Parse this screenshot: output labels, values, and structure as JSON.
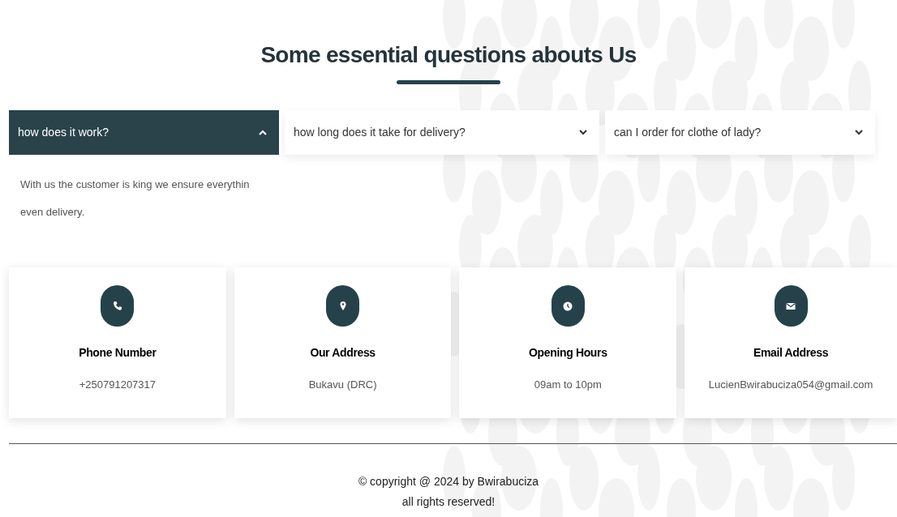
{
  "heading": "Some essential questions abouts Us",
  "faq": [
    {
      "question": "how does it work?",
      "expanded": true,
      "answer": "With us the customer is king we ensure everythin even delivery."
    },
    {
      "question": "how long does it take for delivery?",
      "expanded": false
    },
    {
      "question": "can I order for clothe of lady?",
      "expanded": false
    }
  ],
  "contacts": [
    {
      "kind": "phone",
      "title": "Phone Number",
      "value": "+250791207317"
    },
    {
      "kind": "address",
      "title": "Our Address",
      "value": "Bukavu (DRC)"
    },
    {
      "kind": "hours",
      "title": "Opening Hours",
      "value": "09am to 10pm"
    },
    {
      "kind": "email",
      "title": "Email Address",
      "value": "LucienBwirabuciza054@gmail.com"
    }
  ],
  "footer": {
    "copyright": "© copyright @ 2024 by Bwirabuciza",
    "rights": "all rights reserved!"
  }
}
